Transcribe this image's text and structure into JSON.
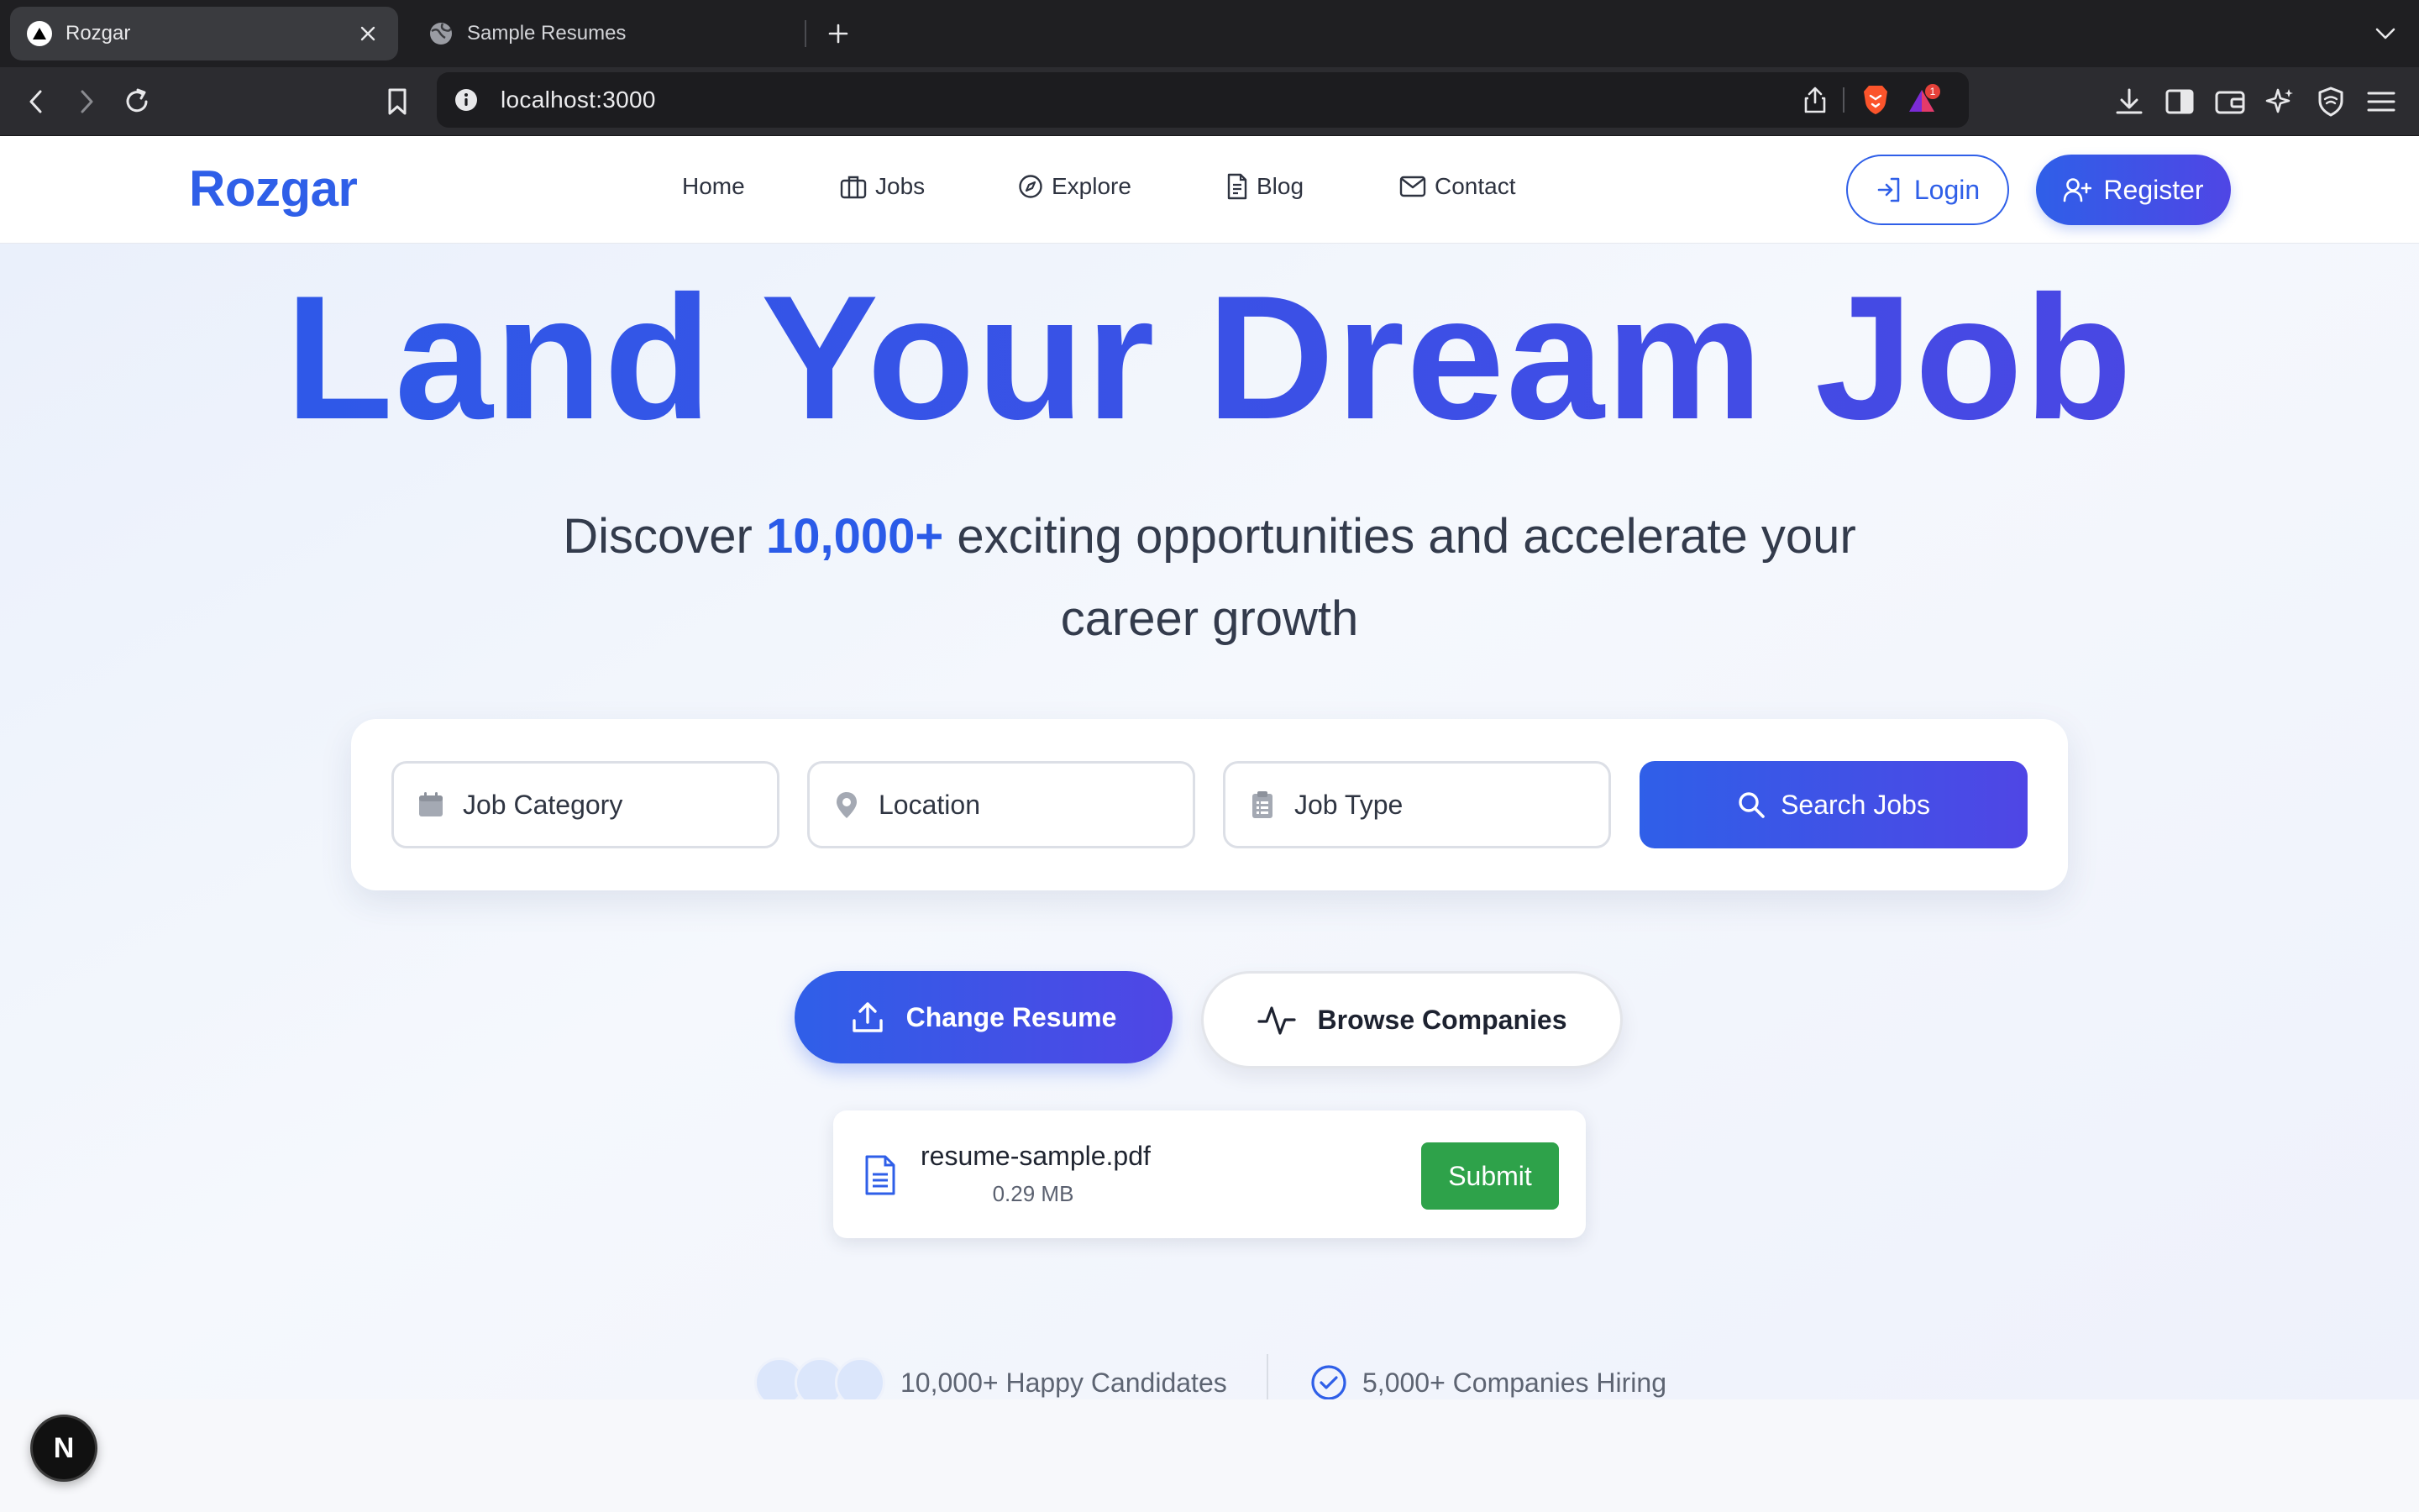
{
  "browser": {
    "tabs": [
      {
        "title": "Rozgar",
        "active": true
      },
      {
        "title": "Sample Resumes",
        "active": false
      }
    ],
    "url": "localhost:3000",
    "extension_badge": "1"
  },
  "nav": {
    "logo": "Rozgar",
    "links": [
      {
        "label": "Home",
        "icon": ""
      },
      {
        "label": "Jobs",
        "icon": "briefcase-icon"
      },
      {
        "label": "Explore",
        "icon": "compass-icon"
      },
      {
        "label": "Blog",
        "icon": "document-icon"
      },
      {
        "label": "Contact",
        "icon": "mail-icon"
      }
    ],
    "login_label": "Login",
    "register_label": "Register"
  },
  "hero": {
    "title": "Land Your Dream Job",
    "subtitle_before": "Discover ",
    "subtitle_highlight": "10,000+",
    "subtitle_after": " exciting opportunities and accelerate your career growth"
  },
  "search": {
    "category_placeholder": "Job Category",
    "location_placeholder": "Location",
    "type_placeholder": "Job Type",
    "button_label": "Search Jobs"
  },
  "actions": {
    "change_resume": "Change Resume",
    "browse_companies": "Browse Companies"
  },
  "upload": {
    "file_name": "resume-sample.pdf",
    "file_size": "0.29 MB",
    "submit_label": "Submit"
  },
  "stats": {
    "candidates": "10,000+ Happy Candidates",
    "companies": "5,000+ Companies Hiring"
  },
  "dev_badge": "N",
  "colors": {
    "primary": "#2f5fe8",
    "indigo": "#4f46e5",
    "success": "#2ea24a",
    "text": "#333b4c"
  }
}
